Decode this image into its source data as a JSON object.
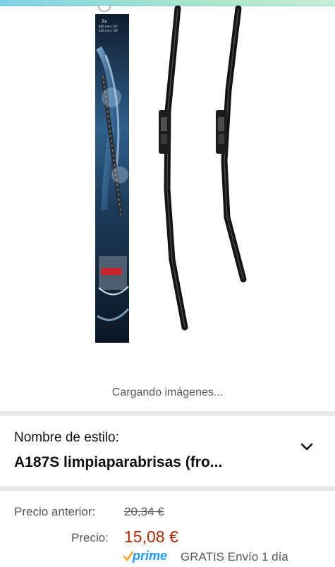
{
  "gallery": {
    "loading_text": "Cargando imágenes...",
    "package_label_line1": "2x",
    "package_label_line2": "600 mm / 24\"",
    "package_label_line3": "450 mm / 18\""
  },
  "style_selector": {
    "label": "Nombre de estilo:",
    "value": "A187S limpiaparabrisas (fro...",
    "icon": "chevron-down-icon"
  },
  "pricing": {
    "previous_label": "Precio anterior:",
    "previous_value": "20,34 €",
    "current_label": "Precio:",
    "current_value": "15,08 €",
    "prime_label": "prime",
    "shipping_text": "GRATIS Envío 1 día"
  },
  "colors": {
    "price_red": "#b12704",
    "prime_blue": "#1a98ff",
    "prime_check_orange": "#f7a623",
    "muted_text": "#565959",
    "divider": "#e7e9ea"
  }
}
